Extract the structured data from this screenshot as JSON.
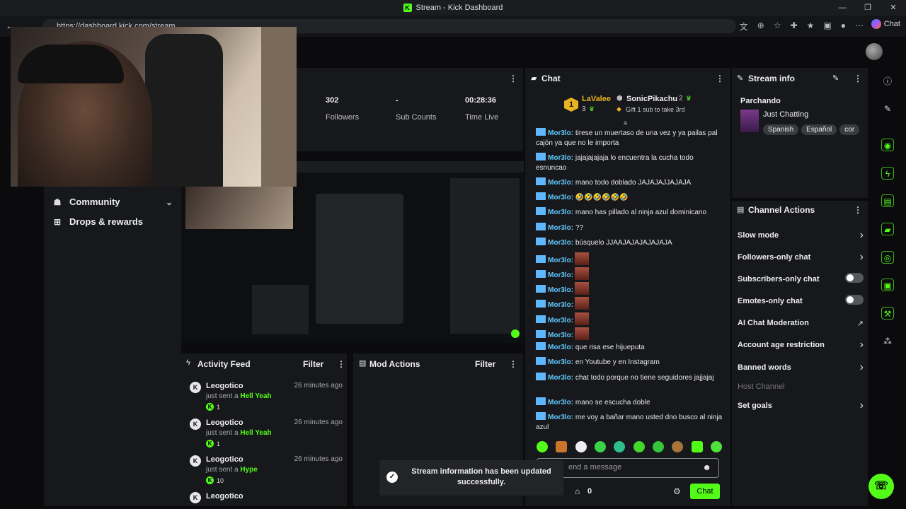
{
  "window": {
    "title": "Stream - Kick Dashboard",
    "url": "https://dashboard.kick.com/stream",
    "chat_button": "Chat"
  },
  "nav": {
    "community": "Community",
    "drops": "Drops & rewards"
  },
  "stats": [
    {
      "value": "302",
      "label": "Followers"
    },
    {
      "value": "-",
      "label": "Sub Counts"
    },
    {
      "value": "00:28:36",
      "label": "Time Live"
    }
  ],
  "activity": {
    "title": "Activity Feed",
    "filter": "Filter",
    "items": [
      {
        "name": "Leogotico",
        "time": "26 minutes ago",
        "pre": "just sent a",
        "gift": "Hell Yeah",
        "amount": "1"
      },
      {
        "name": "Leogotico",
        "time": "26 minutes ago",
        "pre": "just sent a",
        "gift": "Hell Yeah",
        "amount": "1"
      },
      {
        "name": "Leogotico",
        "time": "26 minutes ago",
        "pre": "just sent a",
        "gift": "Hype",
        "amount": "10"
      },
      {
        "name": "Leogotico",
        "time": "",
        "pre": "",
        "gift": "",
        "amount": ""
      }
    ]
  },
  "mod_actions": {
    "title": "Mod Actions",
    "filter": "Filter"
  },
  "chat": {
    "title": "Chat",
    "leader1": {
      "rank": "1",
      "name": "LaValee",
      "count": "3"
    },
    "leader2": {
      "name": "SonicPikachu",
      "count": "2",
      "gift": "Gift 1 sub to take 3rd"
    },
    "messages": [
      {
        "user": "Mor3lo:",
        "text": "tirese un muertaso de una vez y ya pailas pal cajón ya que no le importa"
      },
      {
        "user": "Mor3lo:",
        "text": "jajajajajaja lo encuentra la cucha todo esnuncao"
      },
      {
        "user": "Mor3lo:",
        "text": "mano todo doblado JAJAJAJJAJAJA"
      },
      {
        "user": "Mor3lo:",
        "text": "🤣🤣🤣🤣🤣🤣"
      },
      {
        "user": "Mor3lo:",
        "text": "mano has pillado al ninja azul dominicano"
      },
      {
        "user": "Mor3lo:",
        "text": "??"
      },
      {
        "user": "Mor3lo:",
        "text": "búsquelo JJAAJAJAJAJAJAJA"
      },
      {
        "user": "Mor3lo:",
        "text": ""
      },
      {
        "user": "Mor3lo:",
        "text": ""
      },
      {
        "user": "Mor3lo:",
        "text": ""
      },
      {
        "user": "Mor3lo:",
        "text": ""
      },
      {
        "user": "Mor3lo:",
        "text": ""
      },
      {
        "user": "Mor3lo:",
        "text": ""
      },
      {
        "user": "Mor3lo:",
        "text": "que risa ese hijueputa"
      },
      {
        "user": "Mor3lo:",
        "text": "en Youtube y en Instagram"
      },
      {
        "user": "Mor3lo:",
        "text": "chat todo porque no tiene seguidores jajjajaj"
      },
      {
        "user": "Mor3lo:",
        "text": "mano se escucha doble"
      },
      {
        "user": "Mor3lo:",
        "text": "me voy a bañar mano usted dno busco al ninja azul"
      }
    ],
    "input_placeholder": "end a message",
    "points": "0",
    "send": "Chat"
  },
  "toast": "Stream information has been updated successfully.",
  "stream_info": {
    "title": "Stream info",
    "stream_title": "Parchando",
    "category": "Just Chatting",
    "tags": [
      "Spanish",
      "Español",
      "cor"
    ]
  },
  "channel_actions": {
    "title": "Channel Actions",
    "items": [
      {
        "label": "Slow mode",
        "kind": "chevron"
      },
      {
        "label": "Followers-only chat",
        "kind": "chevron"
      },
      {
        "label": "Subscribers-only chat",
        "kind": "toggle"
      },
      {
        "label": "Emotes-only chat",
        "kind": "toggle"
      },
      {
        "label": "AI Chat Moderation",
        "kind": "external"
      },
      {
        "label": "Account age restriction",
        "kind": "chevron"
      },
      {
        "label": "Banned words",
        "kind": "chevron"
      },
      {
        "label": "Host Channel",
        "kind": "disabled"
      },
      {
        "label": "Set goals",
        "kind": "chevron"
      }
    ]
  },
  "colors": {
    "accent": "#53fc18",
    "username": "#61c8ff"
  }
}
